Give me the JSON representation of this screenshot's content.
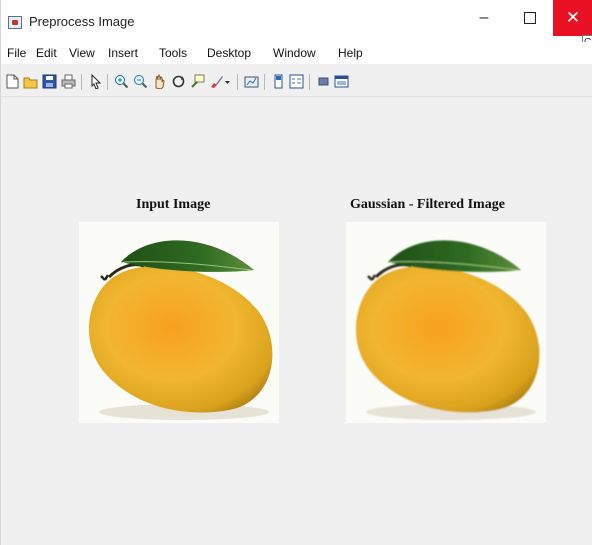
{
  "window": {
    "title": "Preprocess Image",
    "tooltip_fragment": "C",
    "controls": {
      "minimize": "–",
      "maximize": "□",
      "close": "✕"
    }
  },
  "menu": {
    "items": [
      "File",
      "Edit",
      "View",
      "Insert",
      "Tools",
      "Desktop",
      "Window",
      "Help"
    ]
  },
  "toolbar": {
    "icons": [
      "new-figure-icon",
      "open-file-icon",
      "save-icon",
      "print-icon",
      "pointer-icon",
      "zoom-in-icon",
      "zoom-out-icon",
      "pan-icon",
      "rotate-3d-icon",
      "data-cursor-icon",
      "brush-icon",
      "brush-dropdown-icon",
      "link-plot-icon",
      "colorbar-icon",
      "legend-icon",
      "hide-plot-tools-icon",
      "show-plot-tools-icon"
    ]
  },
  "figure": {
    "left_title": "Input Image",
    "right_title": "Gaussian - Filtered Image"
  },
  "colors": {
    "close_button": "#e81123",
    "figure_background": "#f0f0f0",
    "mango_yellow": "#f2b630",
    "leaf_green": "#2f6b22"
  }
}
